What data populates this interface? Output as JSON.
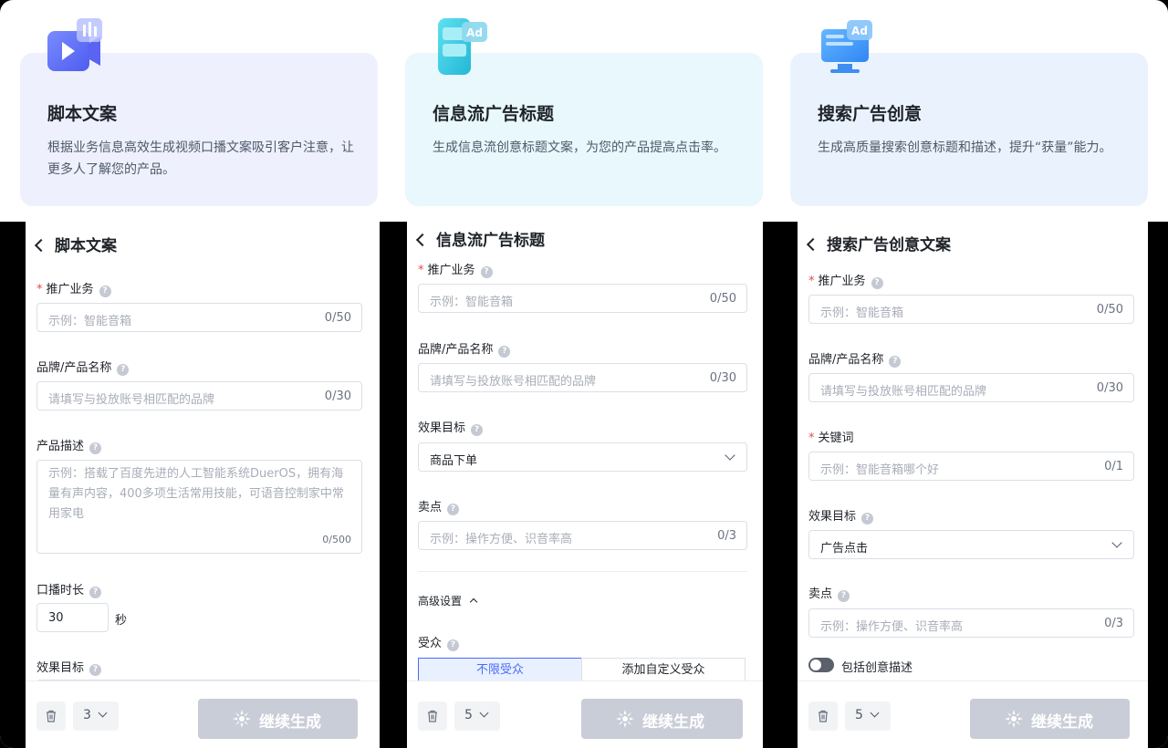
{
  "cards": [
    {
      "title": "脚本文案",
      "desc": "根据业务信息高效生成视频口播文案吸引客户注意，让更多人了解您的产品。",
      "icon": "video-icon",
      "bg": "#eef0fd"
    },
    {
      "title": "信息流广告标题",
      "desc": "生成信息流创意标题文案，为您的产品提高点击率。",
      "icon": "phone-ad-icon",
      "bg": "#e8f8fd",
      "icon_badge": "Ad"
    },
    {
      "title": "搜索广告创意",
      "desc": "生成高质量搜索创意标题和描述，提升“获量”能力。",
      "icon": "monitor-ad-icon",
      "bg": "#eaf3fd",
      "icon_badge": "Ad"
    }
  ],
  "panel1": {
    "title": "脚本文案",
    "f1_label": "推广业务",
    "f1_placeholder": "示例：智能音箱",
    "f1_count": "0/50",
    "f2_label": "品牌/产品名称",
    "f2_placeholder": "请填写与投放账号相匹配的品牌",
    "f2_count": "0/30",
    "f3_label": "产品描述",
    "f3_placeholder": "示例：搭载了百度先进的人工智能系统DuerOS，拥有海量有声内容，400多项生活常用技能，可语音控制家中常用家电",
    "f3_count": "0/500",
    "f4_label": "口播时长",
    "f4_value": "30",
    "f4_unit": "秒",
    "f5_label": "效果目标",
    "count": "3",
    "generate": "继续生成"
  },
  "panel2": {
    "title": "信息流广告标题",
    "f1_label": "推广业务",
    "f1_placeholder": "示例：智能音箱",
    "f1_count": "0/50",
    "f2_label": "品牌/产品名称",
    "f2_placeholder": "请填写与投放账号相匹配的品牌",
    "f2_count": "0/30",
    "f3_label": "效果目标",
    "f3_value": "商品下单",
    "f4_label": "卖点",
    "f4_placeholder": "示例：操作方便、识音率高",
    "f4_count": "0/3",
    "advanced": "高级设置",
    "audience_label": "受众",
    "aud_opt1": "不限受众",
    "aud_opt2": "添加自定义受众",
    "count": "5",
    "generate": "继续生成"
  },
  "panel3": {
    "title": "搜索广告创意文案",
    "f1_label": "推广业务",
    "f1_placeholder": "示例：智能音箱",
    "f1_count": "0/50",
    "f2_label": "品牌/产品名称",
    "f2_placeholder": "请填写与投放账号相匹配的品牌",
    "f2_count": "0/30",
    "f3_label": "关键词",
    "f3_placeholder": "示例：智能音箱哪个好",
    "f3_count": "0/1",
    "f4_label": "效果目标",
    "f4_value": "广告点击",
    "f5_label": "卖点",
    "f5_placeholder": "示例：操作方便、识音率高",
    "f5_count": "0/3",
    "toggle_label": "包括创意描述",
    "count": "5",
    "generate": "继续生成"
  },
  "colors": {
    "accent": "#4a6cf7",
    "required": "#e5484d",
    "disabled_button": "#c9cdd7"
  }
}
